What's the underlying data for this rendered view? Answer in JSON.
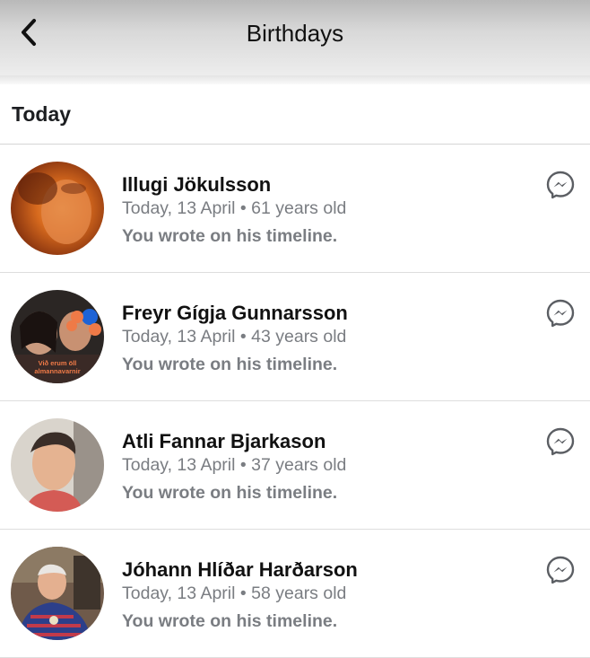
{
  "header": {
    "title": "Birthdays",
    "back_icon": "chevron-left-icon"
  },
  "section": {
    "title": "Today"
  },
  "people": [
    {
      "name": "Illugi Jökulsson",
      "date": "Today, 13 April",
      "age": "61 years old",
      "note": "You wrote on his timeline.",
      "action_icon": "messenger-icon"
    },
    {
      "name": "Freyr Gígja Gunnarsson",
      "date": "Today, 13 April",
      "age": "43 years old",
      "note": "You wrote on his timeline.",
      "action_icon": "messenger-icon",
      "avatar_frame_text": "Við erum öll almannavarnir"
    },
    {
      "name": "Atli Fannar Bjarkason",
      "date": "Today, 13 April",
      "age": "37 years old",
      "note": "You wrote on his timeline.",
      "action_icon": "messenger-icon"
    },
    {
      "name": "Jóhann Hlíðar Harðarson",
      "date": "Today, 13 April",
      "age": "58 years old",
      "note": "You wrote on his timeline.",
      "action_icon": "messenger-icon"
    }
  ],
  "separator": "•"
}
